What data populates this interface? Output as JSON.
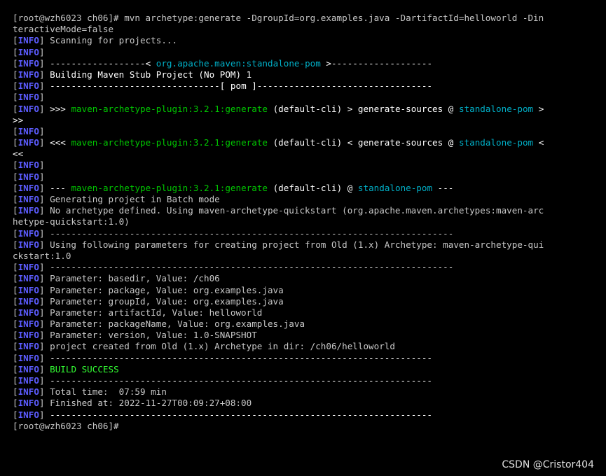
{
  "colors": {
    "background": "#000000",
    "default_text": "#c8c8c8",
    "info_tag": "#5c5cff",
    "bright_text": "#ffffff",
    "plugin_green": "#00c800",
    "project_cyan": "#00b0c8",
    "success_green": "#33ff33"
  },
  "lines": [
    [
      {
        "t": "[root@wzh6023 ch06]# mvn archetype:generate -DgroupId=org.examples.java -DartifactId=helloworld -Din",
        "c": "default"
      }
    ],
    [
      {
        "t": "teractiveMode=false",
        "c": "default"
      }
    ],
    [
      {
        "t": "[",
        "c": "bracket"
      },
      {
        "t": "INFO",
        "c": "info"
      },
      {
        "t": "] Scanning for projects...",
        "c": "default"
      }
    ],
    [
      {
        "t": "[",
        "c": "bracket"
      },
      {
        "t": "INFO",
        "c": "info"
      },
      {
        "t": "]",
        "c": "default"
      }
    ],
    [
      {
        "t": "[",
        "c": "bracket"
      },
      {
        "t": "INFO",
        "c": "info"
      },
      {
        "t": "] ",
        "c": "default"
      },
      {
        "t": "------------------< ",
        "c": "bright"
      },
      {
        "t": "org.apache.maven:standalone-pom",
        "c": "cyan"
      },
      {
        "t": " >-------------------",
        "c": "bright"
      }
    ],
    [
      {
        "t": "[",
        "c": "bracket"
      },
      {
        "t": "INFO",
        "c": "info"
      },
      {
        "t": "] ",
        "c": "default"
      },
      {
        "t": "Building Maven Stub Project (No POM) 1",
        "c": "bright"
      }
    ],
    [
      {
        "t": "[",
        "c": "bracket"
      },
      {
        "t": "INFO",
        "c": "info"
      },
      {
        "t": "] ",
        "c": "default"
      },
      {
        "t": "--------------------------------[ pom ]---------------------------------",
        "c": "bright"
      }
    ],
    [
      {
        "t": "[",
        "c": "bracket"
      },
      {
        "t": "INFO",
        "c": "info"
      },
      {
        "t": "]",
        "c": "default"
      }
    ],
    [
      {
        "t": "[",
        "c": "bracket"
      },
      {
        "t": "INFO",
        "c": "info"
      },
      {
        "t": "] ",
        "c": "default"
      },
      {
        "t": ">>> ",
        "c": "bright"
      },
      {
        "t": "maven-archetype-plugin:3.2.1:generate",
        "c": "green"
      },
      {
        "t": " (default-cli) > generate-sources @ ",
        "c": "bright"
      },
      {
        "t": "standalone-pom",
        "c": "cyan"
      },
      {
        "t": " >",
        "c": "bright"
      }
    ],
    [
      {
        "t": ">>",
        "c": "bright"
      }
    ],
    [
      {
        "t": "[",
        "c": "bracket"
      },
      {
        "t": "INFO",
        "c": "info"
      },
      {
        "t": "]",
        "c": "default"
      }
    ],
    [
      {
        "t": "[",
        "c": "bracket"
      },
      {
        "t": "INFO",
        "c": "info"
      },
      {
        "t": "] ",
        "c": "default"
      },
      {
        "t": "<<< ",
        "c": "bright"
      },
      {
        "t": "maven-archetype-plugin:3.2.1:generate",
        "c": "green"
      },
      {
        "t": " (default-cli) < generate-sources @ ",
        "c": "bright"
      },
      {
        "t": "standalone-pom",
        "c": "cyan"
      },
      {
        "t": " <",
        "c": "bright"
      }
    ],
    [
      {
        "t": "<<",
        "c": "bright"
      }
    ],
    [
      {
        "t": "[",
        "c": "bracket"
      },
      {
        "t": "INFO",
        "c": "info"
      },
      {
        "t": "]",
        "c": "default"
      }
    ],
    [
      {
        "t": "[",
        "c": "bracket"
      },
      {
        "t": "INFO",
        "c": "info"
      },
      {
        "t": "]",
        "c": "default"
      }
    ],
    [
      {
        "t": "[",
        "c": "bracket"
      },
      {
        "t": "INFO",
        "c": "info"
      },
      {
        "t": "] ",
        "c": "default"
      },
      {
        "t": "--- ",
        "c": "bright"
      },
      {
        "t": "maven-archetype-plugin:3.2.1:generate",
        "c": "green"
      },
      {
        "t": " (default-cli) @ ",
        "c": "bright"
      },
      {
        "t": "standalone-pom",
        "c": "cyan"
      },
      {
        "t": " ---",
        "c": "bright"
      }
    ],
    [
      {
        "t": "[",
        "c": "bracket"
      },
      {
        "t": "INFO",
        "c": "info"
      },
      {
        "t": "] Generating project in Batch mode",
        "c": "default"
      }
    ],
    [
      {
        "t": "[",
        "c": "bracket"
      },
      {
        "t": "INFO",
        "c": "info"
      },
      {
        "t": "] No archetype defined. Using maven-archetype-quickstart (org.apache.maven.archetypes:maven-arc",
        "c": "default"
      }
    ],
    [
      {
        "t": "hetype-quickstart:1.0)",
        "c": "default"
      }
    ],
    [
      {
        "t": "[",
        "c": "bracket"
      },
      {
        "t": "INFO",
        "c": "info"
      },
      {
        "t": "] ----------------------------------------------------------------------------",
        "c": "default"
      }
    ],
    [
      {
        "t": "[",
        "c": "bracket"
      },
      {
        "t": "INFO",
        "c": "info"
      },
      {
        "t": "] Using following parameters for creating project from Old (1.x) Archetype: maven-archetype-qui",
        "c": "default"
      }
    ],
    [
      {
        "t": "ckstart:1.0",
        "c": "default"
      }
    ],
    [
      {
        "t": "[",
        "c": "bracket"
      },
      {
        "t": "INFO",
        "c": "info"
      },
      {
        "t": "] ----------------------------------------------------------------------------",
        "c": "default"
      }
    ],
    [
      {
        "t": "[",
        "c": "bracket"
      },
      {
        "t": "INFO",
        "c": "info"
      },
      {
        "t": "] Parameter: basedir, Value: /ch06",
        "c": "default"
      }
    ],
    [
      {
        "t": "[",
        "c": "bracket"
      },
      {
        "t": "INFO",
        "c": "info"
      },
      {
        "t": "] Parameter: package, Value: org.examples.java",
        "c": "default"
      }
    ],
    [
      {
        "t": "[",
        "c": "bracket"
      },
      {
        "t": "INFO",
        "c": "info"
      },
      {
        "t": "] Parameter: groupId, Value: org.examples.java",
        "c": "default"
      }
    ],
    [
      {
        "t": "[",
        "c": "bracket"
      },
      {
        "t": "INFO",
        "c": "info"
      },
      {
        "t": "] Parameter: artifactId, Value: helloworld",
        "c": "default"
      }
    ],
    [
      {
        "t": "[",
        "c": "bracket"
      },
      {
        "t": "INFO",
        "c": "info"
      },
      {
        "t": "] Parameter: packageName, Value: org.examples.java",
        "c": "default"
      }
    ],
    [
      {
        "t": "[",
        "c": "bracket"
      },
      {
        "t": "INFO",
        "c": "info"
      },
      {
        "t": "] Parameter: version, Value: 1.0-SNAPSHOT",
        "c": "default"
      }
    ],
    [
      {
        "t": "[",
        "c": "bracket"
      },
      {
        "t": "INFO",
        "c": "info"
      },
      {
        "t": "] project created from Old (1.x) Archetype in dir: /ch06/helloworld",
        "c": "default"
      }
    ],
    [
      {
        "t": "[",
        "c": "bracket"
      },
      {
        "t": "INFO",
        "c": "info"
      },
      {
        "t": "] ",
        "c": "default"
      },
      {
        "t": "------------------------------------------------------------------------",
        "c": "bright"
      }
    ],
    [
      {
        "t": "[",
        "c": "bracket"
      },
      {
        "t": "INFO",
        "c": "info"
      },
      {
        "t": "] ",
        "c": "default"
      },
      {
        "t": "BUILD SUCCESS",
        "c": "success"
      }
    ],
    [
      {
        "t": "[",
        "c": "bracket"
      },
      {
        "t": "INFO",
        "c": "info"
      },
      {
        "t": "] ",
        "c": "default"
      },
      {
        "t": "------------------------------------------------------------------------",
        "c": "bright"
      }
    ],
    [
      {
        "t": "[",
        "c": "bracket"
      },
      {
        "t": "INFO",
        "c": "info"
      },
      {
        "t": "] Total time:  07:59 min",
        "c": "default"
      }
    ],
    [
      {
        "t": "[",
        "c": "bracket"
      },
      {
        "t": "INFO",
        "c": "info"
      },
      {
        "t": "] Finished at: 2022-11-27T00:09:27+08:00",
        "c": "default"
      }
    ],
    [
      {
        "t": "[",
        "c": "bracket"
      },
      {
        "t": "INFO",
        "c": "info"
      },
      {
        "t": "] ",
        "c": "default"
      },
      {
        "t": "------------------------------------------------------------------------",
        "c": "bright"
      }
    ],
    [
      {
        "t": "[root@wzh6023 ch06]#",
        "c": "default"
      }
    ]
  ],
  "watermark": "CSDN @Cristor404"
}
